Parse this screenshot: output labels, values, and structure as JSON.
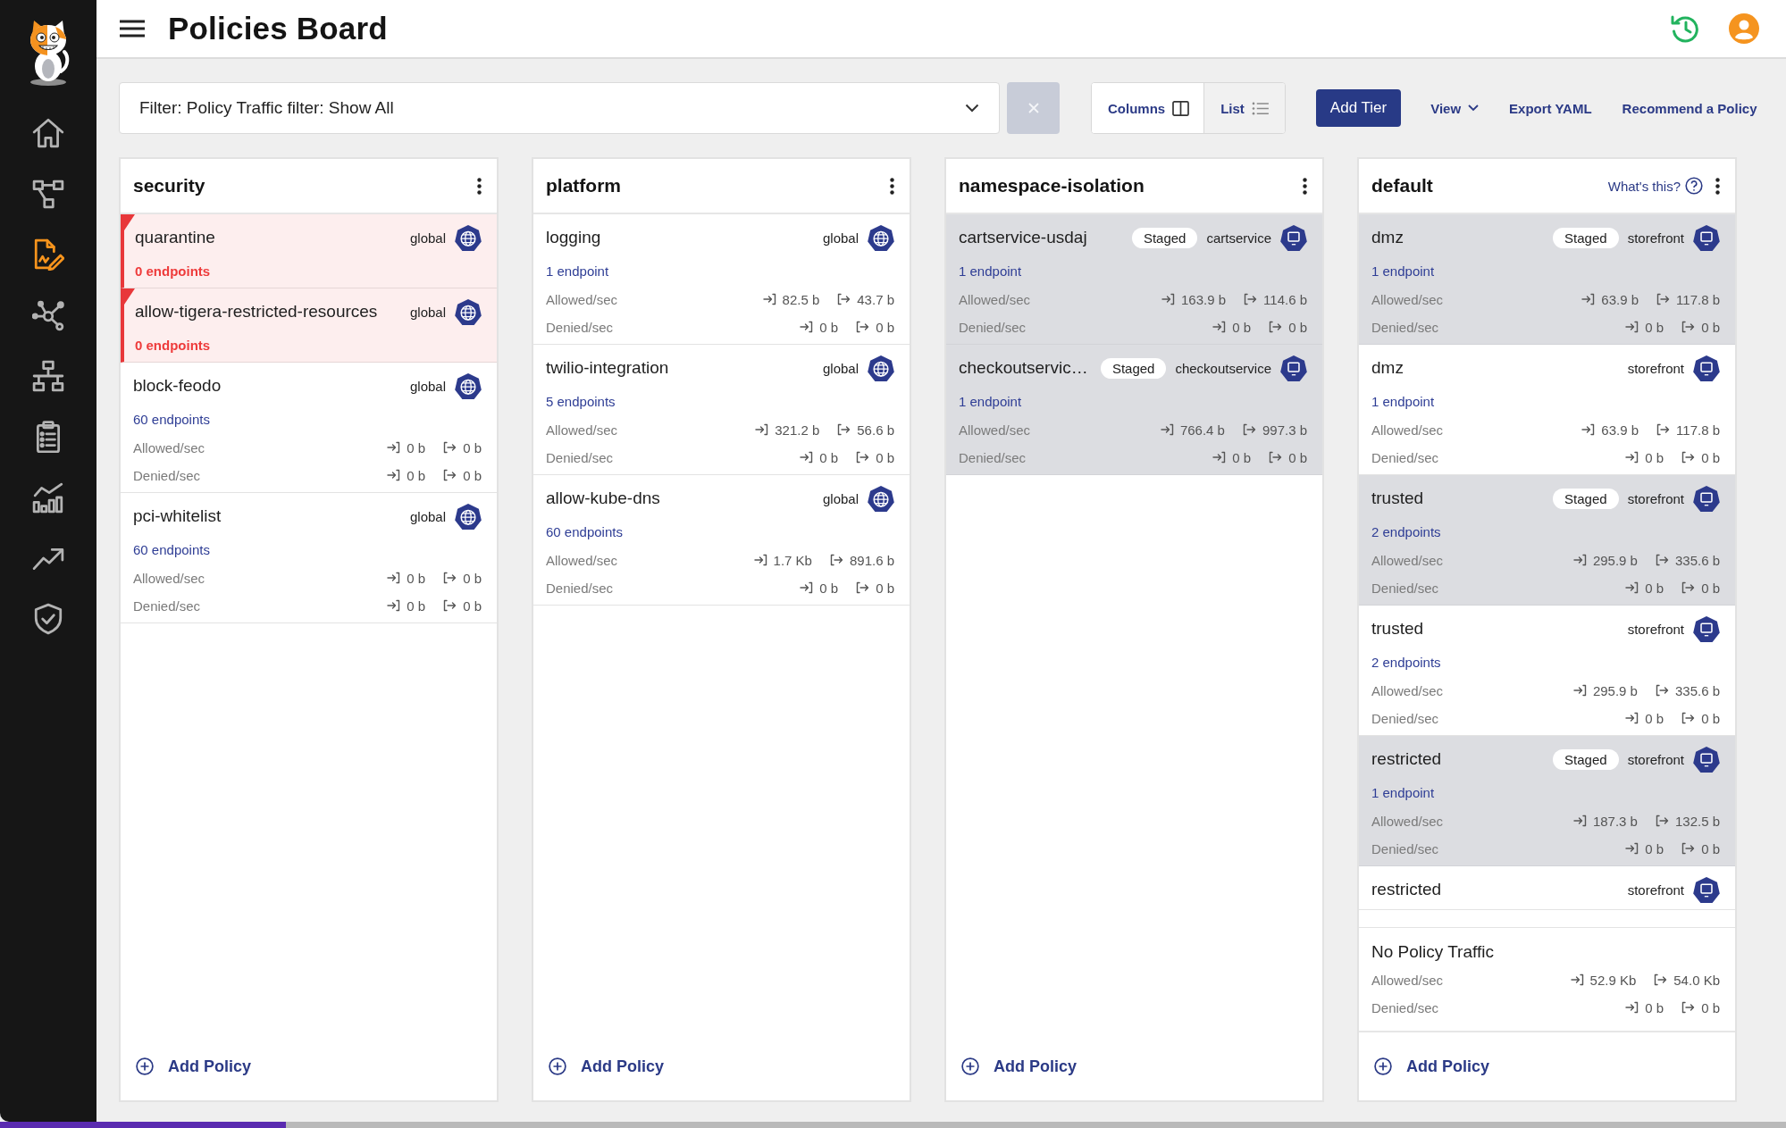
{
  "sidebar": {
    "items": [
      {
        "kind": "home",
        "selected": false
      },
      {
        "kind": "topology",
        "selected": false
      },
      {
        "kind": "policies",
        "selected": true
      },
      {
        "kind": "graph",
        "selected": false
      },
      {
        "kind": "hierarchy",
        "selected": false
      },
      {
        "kind": "checklist",
        "selected": false
      },
      {
        "kind": "dashboard",
        "selected": false
      },
      {
        "kind": "trends",
        "selected": false
      },
      {
        "kind": "compliance",
        "selected": false
      }
    ]
  },
  "header": {
    "title": "Policies Board"
  },
  "toolbar": {
    "filter": {
      "value": "Filter: Policy Traffic filter: Show All"
    },
    "views": [
      {
        "label": "Columns",
        "kind": "columns",
        "selected": true
      },
      {
        "label": "List",
        "kind": "list",
        "selected": false
      }
    ],
    "actions": [
      {
        "label": "Add Tier",
        "kind": "primary"
      },
      {
        "label": "View",
        "kind": "menu"
      },
      {
        "label": "Export YAML",
        "kind": "link"
      },
      {
        "label": "Recommend a Policy",
        "kind": "link"
      }
    ]
  },
  "tiers": [
    {
      "title": "security",
      "policies": [
        {
          "name": "quarantine",
          "scope": {
            "label": "global",
            "kind": "global"
          },
          "staged": false,
          "warning": true,
          "endpoints": "0 endpoints"
        },
        {
          "name": "allow-tigera-restricted-resources",
          "scope": {
            "label": "global",
            "kind": "global"
          },
          "staged": false,
          "warning": true,
          "endpoints": "0 endpoints"
        },
        {
          "name": "block-feodo",
          "scope": {
            "label": "global",
            "kind": "global"
          },
          "staged": false,
          "warning": false,
          "endpoints": "60 endpoints",
          "stats": [
            {
              "label": "Allowed/sec",
              "in": "0 b",
              "out": "0 b"
            },
            {
              "label": "Denied/sec",
              "in": "0 b",
              "out": "0 b"
            }
          ]
        },
        {
          "name": "pci-whitelist",
          "scope": {
            "label": "global",
            "kind": "global"
          },
          "staged": false,
          "warning": false,
          "endpoints": "60 endpoints",
          "stats": [
            {
              "label": "Allowed/sec",
              "in": "0 b",
              "out": "0 b"
            },
            {
              "label": "Denied/sec",
              "in": "0 b",
              "out": "0 b"
            }
          ]
        }
      ],
      "add_label": "Add Policy"
    },
    {
      "title": "platform",
      "policies": [
        {
          "name": "logging",
          "scope": {
            "label": "global",
            "kind": "global"
          },
          "staged": false,
          "warning": false,
          "endpoints": "1 endpoint",
          "stats": [
            {
              "label": "Allowed/sec",
              "in": "82.5 b",
              "out": "43.7 b"
            },
            {
              "label": "Denied/sec",
              "in": "0 b",
              "out": "0 b"
            }
          ]
        },
        {
          "name": "twilio-integration",
          "scope": {
            "label": "global",
            "kind": "global"
          },
          "staged": false,
          "warning": false,
          "endpoints": "5 endpoints",
          "stats": [
            {
              "label": "Allowed/sec",
              "in": "321.2 b",
              "out": "56.6 b"
            },
            {
              "label": "Denied/sec",
              "in": "0 b",
              "out": "0 b"
            }
          ]
        },
        {
          "name": "allow-kube-dns",
          "scope": {
            "label": "global",
            "kind": "global"
          },
          "staged": false,
          "warning": false,
          "endpoints": "60 endpoints",
          "stats": [
            {
              "label": "Allowed/sec",
              "in": "1.7 Kb",
              "out": "891.6 b"
            },
            {
              "label": "Denied/sec",
              "in": "0 b",
              "out": "0 b"
            }
          ]
        }
      ],
      "add_label": "Add Policy"
    },
    {
      "title": "namespace-isolation",
      "policies": [
        {
          "name": "cartservice-usdaj",
          "tag": "Staged",
          "scope": {
            "label": "cartservice",
            "kind": "namespace"
          },
          "staged": true,
          "warning": false,
          "endpoints": "1 endpoint",
          "stats": [
            {
              "label": "Allowed/sec",
              "in": "163.9 b",
              "out": "114.6 b"
            },
            {
              "label": "Denied/sec",
              "in": "0 b",
              "out": "0 b"
            }
          ]
        },
        {
          "name": "checkoutservic…",
          "tag": "Staged",
          "scope": {
            "label": "checkoutservice",
            "kind": "namespace"
          },
          "staged": true,
          "warning": false,
          "endpoints": "1 endpoint",
          "stats": [
            {
              "label": "Allowed/sec",
              "in": "766.4 b",
              "out": "997.3 b"
            },
            {
              "label": "Denied/sec",
              "in": "0 b",
              "out": "0 b"
            }
          ]
        }
      ],
      "add_label": "Add Policy"
    },
    {
      "title": "default",
      "help": "What's this?",
      "policies": [
        {
          "name": "dmz",
          "tag": "Staged",
          "scope": {
            "label": "storefront",
            "kind": "namespace"
          },
          "staged": true,
          "warning": false,
          "endpoints": "1 endpoint",
          "stats": [
            {
              "label": "Allowed/sec",
              "in": "63.9 b",
              "out": "117.8 b"
            },
            {
              "label": "Denied/sec",
              "in": "0 b",
              "out": "0 b"
            }
          ]
        },
        {
          "name": "dmz",
          "scope": {
            "label": "storefront",
            "kind": "namespace"
          },
          "staged": false,
          "warning": false,
          "endpoints": "1 endpoint",
          "stats": [
            {
              "label": "Allowed/sec",
              "in": "63.9 b",
              "out": "117.8 b"
            },
            {
              "label": "Denied/sec",
              "in": "0 b",
              "out": "0 b"
            }
          ]
        },
        {
          "name": "trusted",
          "tag": "Staged",
          "scope": {
            "label": "storefront",
            "kind": "namespace"
          },
          "staged": true,
          "warning": false,
          "endpoints": "2 endpoints",
          "stats": [
            {
              "label": "Allowed/sec",
              "in": "295.9 b",
              "out": "335.6 b"
            },
            {
              "label": "Denied/sec",
              "in": "0 b",
              "out": "0 b"
            }
          ]
        },
        {
          "name": "trusted",
          "scope": {
            "label": "storefront",
            "kind": "namespace"
          },
          "staged": false,
          "warning": false,
          "endpoints": "2 endpoints",
          "stats": [
            {
              "label": "Allowed/sec",
              "in": "295.9 b",
              "out": "335.6 b"
            },
            {
              "label": "Denied/sec",
              "in": "0 b",
              "out": "0 b"
            }
          ]
        },
        {
          "name": "restricted",
          "tag": "Staged",
          "scope": {
            "label": "storefront",
            "kind": "namespace"
          },
          "staged": true,
          "warning": false,
          "endpoints": "1 endpoint",
          "stats": [
            {
              "label": "Allowed/sec",
              "in": "187.3 b",
              "out": "132.5 b"
            },
            {
              "label": "Denied/sec",
              "in": "0 b",
              "out": "0 b"
            }
          ]
        },
        {
          "name": "restricted",
          "scope": {
            "label": "storefront",
            "kind": "namespace"
          },
          "staged": false,
          "warning": false
        }
      ],
      "unassigned": {
        "title": "No Policy Traffic",
        "stats": [
          {
            "label": "Allowed/sec",
            "in": "52.9 Kb",
            "out": "54.0 Kb"
          },
          {
            "label": "Denied/sec",
            "in": "0 b",
            "out": "0 b"
          }
        ]
      },
      "add_label": "Add Policy"
    }
  ]
}
